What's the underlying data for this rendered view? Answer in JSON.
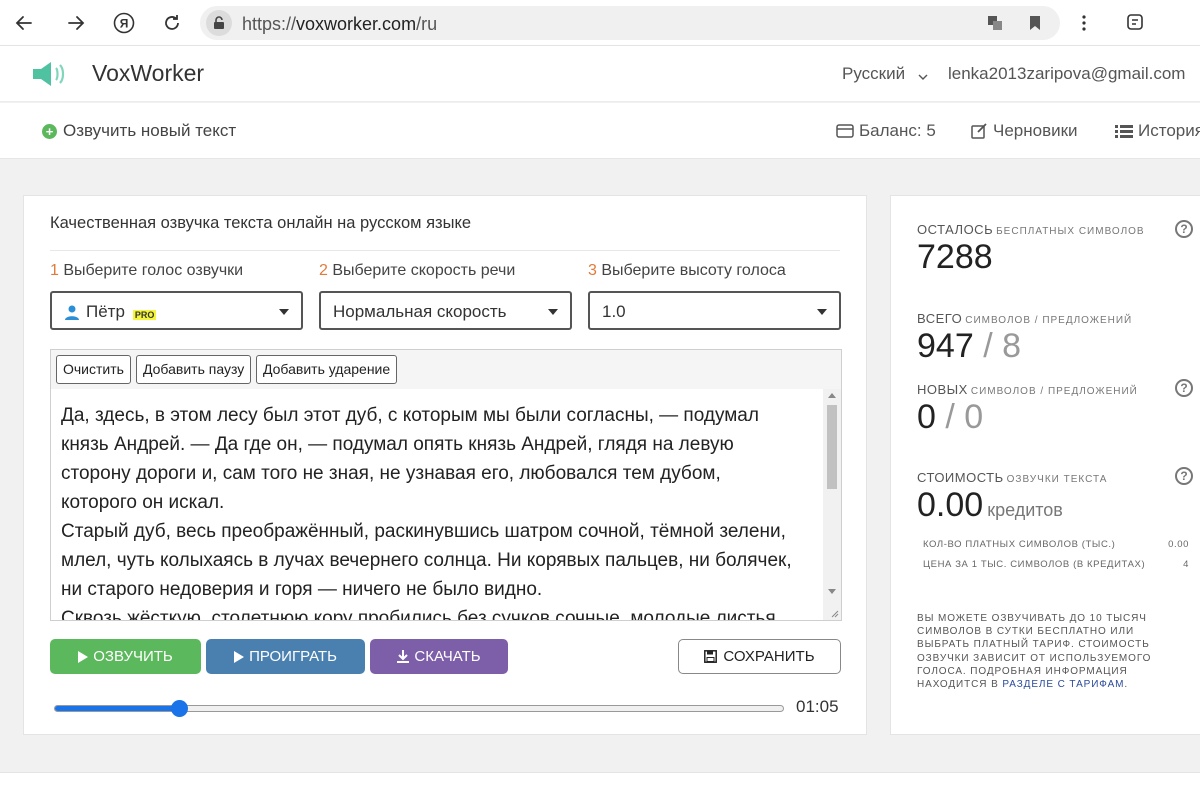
{
  "browser": {
    "url_prefix": "https://",
    "url_domain": "voxworker.com",
    "url_path": "/ru",
    "icons": [
      "back-icon",
      "forward-icon",
      "yandex-icon",
      "reload-icon",
      "lock-icon",
      "translate-icon",
      "bookmark-icon",
      "menu-dots-icon",
      "extensions-icon"
    ]
  },
  "header": {
    "logo_text": "VoxWorker",
    "language": "Русский",
    "user_email": "lenka2013zaripova@gmail.com"
  },
  "subnav": {
    "new_text": "Озвучить новый текст",
    "balance": "Баланс: 5",
    "drafts": "Черновики",
    "history": "История"
  },
  "main": {
    "title": "Качественная озвучка текста онлайн на русском языке",
    "steps": [
      {
        "num": "1",
        "label": "Выберите голос озвучки",
        "value": "Пётр",
        "badge": "PRO"
      },
      {
        "num": "2",
        "label": "Выберите скорость речи",
        "value": "Нормальная скорость"
      },
      {
        "num": "3",
        "label": "Выберите высоту голоса",
        "value": "1.0"
      }
    ],
    "toolbar": {
      "clear": "Очистить",
      "add_pause": "Добавить паузу",
      "add_stress": "Добавить ударение"
    },
    "text_lines": [
      "Да, здесь, в этом лесу был этот дуб, с которым мы были согласны, — подумал",
      "князь Андрей. — Да где он, — подумал опять князь Андрей, глядя на левую",
      "сторону дороги и, сам того не зная, не узнавая его, любовался тем дубом,",
      "которого он искал.",
      "Старый дуб, весь преображённый, раскинувшись шатром сочной, тёмной зелени,",
      "млел, чуть колыхаясь в лучах вечернего солнца. Ни корявых пальцев, ни болячек,",
      "ни старого недоверия и горя — ничего не было видно.",
      "Сквозь жёсткую, столетнюю кору пробились без сучков сочные, молодые листья"
    ],
    "buttons": {
      "voice": "ОЗВУЧИТЬ",
      "play": "ПРОИГРАТЬ",
      "download": "СКАЧАТЬ",
      "save": "СОХРАНИТЬ"
    },
    "player": {
      "progress": 0.17,
      "time": "01:05"
    }
  },
  "side": {
    "remaining_label": "ОСТАЛОСЬ",
    "remaining_sub": "БЕСПЛАТНЫХ СИМВОЛОВ",
    "remaining_value": "7288",
    "total_label": "ВСЕГО",
    "total_sub": "СИМВОЛОВ / ПРЕДЛОЖЕНИЙ",
    "total_chars": "947",
    "total_sentences": "8",
    "new_label": "НОВЫХ",
    "new_sub": "СИМВОЛОВ / ПРЕДЛОЖЕНИЙ",
    "new_chars": "0",
    "new_sentences": "0",
    "cost_label": "СТОИМОСТЬ",
    "cost_sub": "ОЗВУЧКИ ТЕКСТА",
    "cost_value": "0.00",
    "cost_unit": "кредитов",
    "paid_chars_label": "КОЛ-ВО ПЛАТНЫХ СИМВОЛОВ (ТЫС.)",
    "paid_chars_value": "0.00",
    "price_label": "ЦЕНА ЗА 1 ТЫС. СИМВОЛОВ (В КРЕДИТАХ)",
    "price_value": "4",
    "separator": "/",
    "help_glyph": "?",
    "note": "ВЫ МОЖЕТЕ ОЗВУЧИВАТЬ ДО 10 ТЫСЯЧ СИМВОЛОВ В СУТКИ БЕСПЛАТНО ИЛИ ВЫБРАТЬ ПЛАТНЫЙ ТАРИФ. СТОИМОСТЬ ОЗВУЧКИ ЗАВИСИТ ОТ ИСПОЛЬЗУЕМОГО ГОЛОСА. ПОДРОБНАЯ ИНФОРМАЦИЯ НАХОДИТСЯ В",
    "note_link": "РАЗДЕЛЕ С ТАРИФАМ",
    "note_end": "."
  },
  "colors": {
    "accent_orange": "#e07b3c",
    "green": "#5cb85c",
    "blue": "#4a80b0",
    "purple": "#7d5ea8",
    "slider": "#1a73e8"
  }
}
